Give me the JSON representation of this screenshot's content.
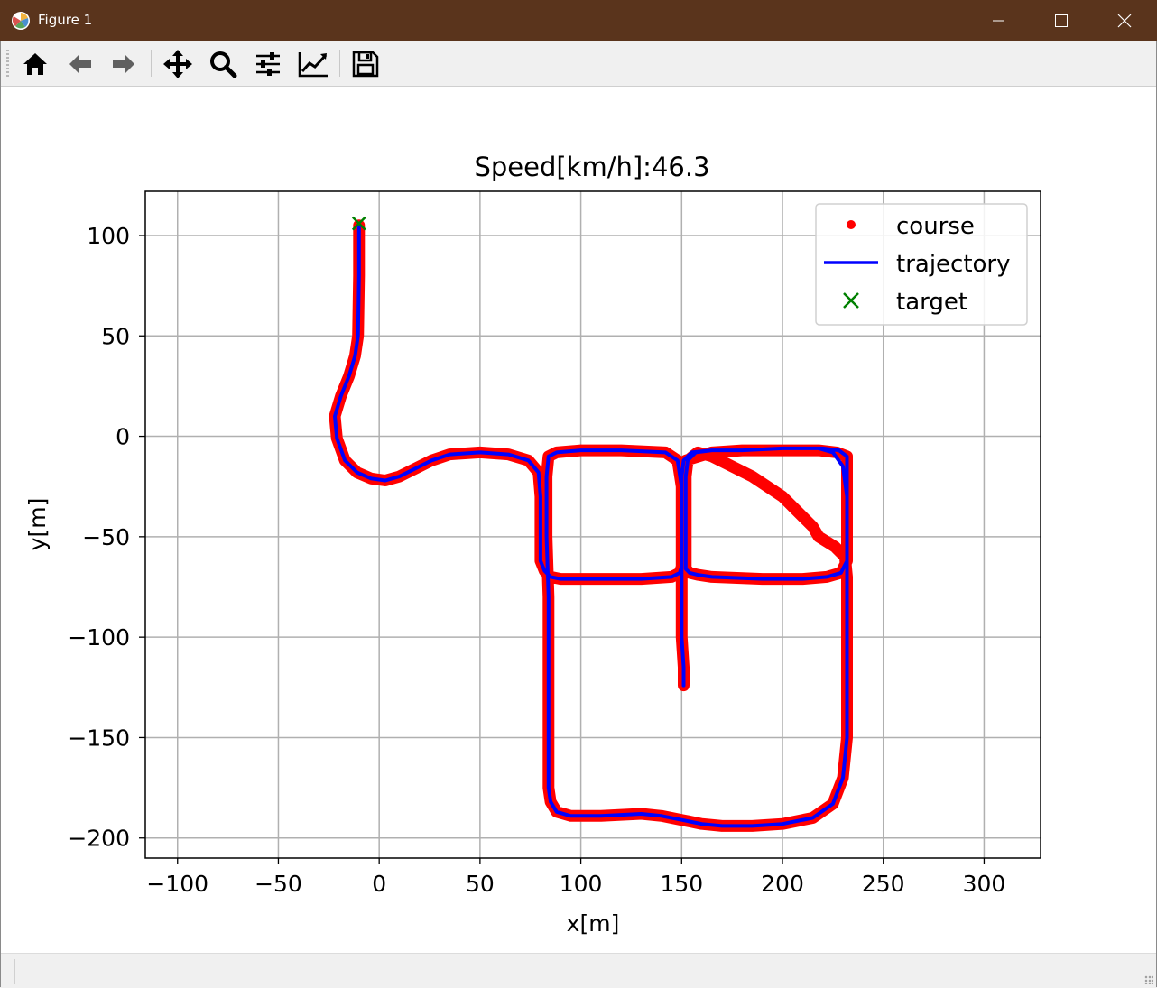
{
  "window": {
    "title": "Figure 1",
    "titlebar_color": "#5a341c",
    "controls": [
      "minimize-icon",
      "maximize-icon",
      "close-icon"
    ]
  },
  "toolbar": {
    "buttons": [
      {
        "name": "home-button",
        "icon": "home-icon",
        "label": "Home"
      },
      {
        "name": "back-button",
        "icon": "arrow-left-icon",
        "label": "Back"
      },
      {
        "name": "forward-button",
        "icon": "arrow-right-icon",
        "label": "Forward"
      },
      {
        "name": "pan-button",
        "icon": "move-icon",
        "label": "Pan"
      },
      {
        "name": "zoom-button",
        "icon": "magnifier-icon",
        "label": "Zoom"
      },
      {
        "name": "configure-subplots-button",
        "icon": "sliders-icon",
        "label": "Subplots"
      },
      {
        "name": "edit-axis-button",
        "icon": "line-chart-icon",
        "label": "Customize"
      },
      {
        "name": "save-button",
        "icon": "floppy-disk-icon",
        "label": "Save"
      }
    ]
  },
  "chart_data": {
    "type": "line",
    "title": "Speed[km/h]:46.3",
    "xlabel": "x[m]",
    "ylabel": "y[m]",
    "xlim": [
      -116,
      328
    ],
    "ylim": [
      -210,
      122
    ],
    "xticks": [
      -100,
      -50,
      0,
      50,
      100,
      150,
      200,
      250,
      300
    ],
    "yticks": [
      100,
      50,
      0,
      -50,
      -100,
      -150,
      -200
    ],
    "xtick_labels": [
      "−100",
      "−50",
      "0",
      "50",
      "100",
      "150",
      "200",
      "250",
      "300"
    ],
    "ytick_labels": [
      "100",
      "50",
      "0",
      "−50",
      "−100",
      "−150",
      "−200"
    ],
    "grid": true,
    "legend_position": "top-right",
    "series": [
      {
        "name": "course",
        "style": "points",
        "color": "#ff0000",
        "x": [
          -10,
          -10,
          -10.5,
          -12,
          -15,
          -19,
          -22,
          -21,
          -17,
          -11,
          -4,
          3,
          10,
          18,
          26,
          35,
          50,
          64,
          74,
          79,
          80,
          80,
          80,
          82,
          85,
          90,
          110,
          130,
          145,
          149,
          150,
          150,
          150,
          148,
          142,
          120,
          100,
          88,
          84,
          83,
          83,
          84,
          84,
          84,
          84,
          84,
          85,
          88,
          95,
          110,
          130,
          140,
          150,
          160,
          170,
          185,
          200,
          215,
          225,
          230,
          232,
          232,
          232,
          232,
          232,
          231,
          226,
          218,
          215,
          210,
          200,
          185,
          175,
          165,
          158,
          153,
          152,
          152,
          152,
          152,
          152,
          154,
          158,
          165,
          190,
          210,
          222,
          229,
          232,
          232,
          232,
          232,
          232,
          227,
          218,
          200,
          180,
          165,
          152,
          150,
          150,
          150,
          150,
          150,
          151,
          151
        ],
        "y": [
          105,
          80,
          50,
          40,
          30,
          20,
          10,
          -1,
          -12,
          -18,
          -21,
          -22,
          -20,
          -16,
          -12,
          -9,
          -8,
          -9,
          -12,
          -18,
          -30,
          -50,
          -62,
          -67,
          -70,
          -71,
          -71,
          -71,
          -70,
          -68,
          -65,
          -50,
          -25,
          -12,
          -8,
          -7,
          -7,
          -8,
          -10,
          -20,
          -50,
          -80,
          -110,
          -140,
          -160,
          -175,
          -182,
          -187,
          -189,
          -189,
          -188,
          -189,
          -191,
          -193,
          -194,
          -194,
          -193,
          -190,
          -183,
          -170,
          -150,
          -130,
          -110,
          -90,
          -70,
          -60,
          -55,
          -50,
          -45,
          -40,
          -30,
          -20,
          -15,
          -10,
          -8,
          -12,
          -20,
          -35,
          -50,
          -60,
          -66,
          -68,
          -69,
          -70,
          -71,
          -71,
          -70,
          -68,
          -62,
          -50,
          -25,
          -15,
          -10,
          -8,
          -7,
          -7,
          -7,
          -8,
          -12,
          -20,
          -40,
          -60,
          -80,
          -100,
          -115,
          -124
        ],
        "note": ""
      },
      {
        "name": "trajectory",
        "style": "line",
        "color": "#0000ff",
        "x": [
          -10,
          -10,
          -10.5,
          -12,
          -15,
          -19,
          -22,
          -21,
          -17,
          -11,
          -4,
          3,
          10,
          18,
          26,
          35,
          50,
          64,
          74,
          79,
          80,
          80,
          80,
          82,
          85,
          90,
          110,
          130,
          145,
          149,
          150,
          150,
          150,
          148,
          142,
          120,
          100,
          88,
          84,
          83,
          83,
          84,
          84,
          84,
          84,
          84,
          85,
          88,
          95,
          110,
          130,
          140,
          150,
          160,
          170,
          185,
          200,
          215,
          225,
          230,
          232,
          232,
          232,
          232,
          232,
          232,
          232,
          230,
          225,
          218,
          200,
          180,
          165,
          157,
          153,
          152,
          152,
          152,
          152,
          152,
          154,
          158,
          165,
          190,
          210,
          222,
          229,
          232,
          232,
          232,
          232,
          232,
          228,
          220,
          200,
          180,
          165,
          155,
          151,
          150,
          150,
          150,
          150,
          150,
          151,
          151
        ],
        "y": [
          105,
          80,
          50,
          40,
          30,
          20,
          10,
          -1,
          -12,
          -18,
          -21,
          -22,
          -20,
          -16,
          -12,
          -9,
          -8,
          -9,
          -12,
          -18,
          -30,
          -50,
          -62,
          -67,
          -70,
          -71,
          -71,
          -71,
          -70,
          -68,
          -65,
          -50,
          -25,
          -12,
          -8,
          -7,
          -7,
          -8,
          -10,
          -20,
          -50,
          -80,
          -110,
          -140,
          -160,
          -175,
          -182,
          -187,
          -189,
          -189,
          -188,
          -189,
          -191,
          -193,
          -194,
          -194,
          -193,
          -190,
          -183,
          -170,
          -150,
          -130,
          -110,
          -90,
          -70,
          -50,
          -30,
          -15,
          -8,
          -6,
          -6,
          -7,
          -7,
          -8,
          -12,
          -20,
          -35,
          -50,
          -60,
          -66,
          -68,
          -69,
          -70,
          -71,
          -71,
          -70,
          -68,
          -62,
          -50,
          -25,
          -15,
          -10,
          -7,
          -6,
          -6,
          -7,
          -7,
          -8,
          -12,
          -20,
          -40,
          -60,
          -80,
          -100,
          -115,
          -124
        ]
      },
      {
        "name": "target",
        "style": "x-marker",
        "color": "#008000",
        "x": [
          -10
        ],
        "y": [
          106
        ]
      }
    ]
  }
}
